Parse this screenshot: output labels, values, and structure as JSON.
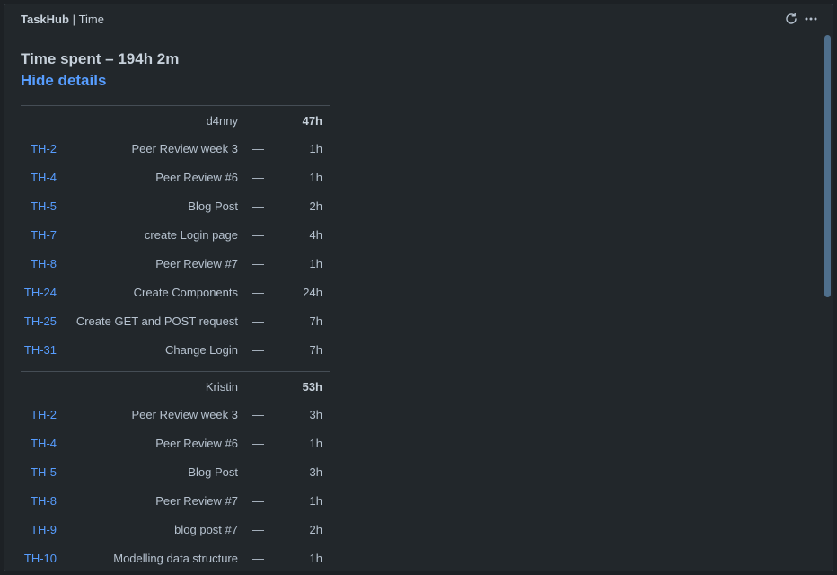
{
  "header": {
    "app": "TaskHub",
    "separator": "|",
    "view": "Time",
    "refresh_icon": "refresh-icon",
    "more_icon": "more-horizontal-icon"
  },
  "summary": {
    "title": "Time spent – 194h 2m",
    "toggle_label": "Hide details"
  },
  "groups": [
    {
      "user": "d4nny",
      "total": "47h",
      "rows": [
        {
          "key": "TH-2",
          "summary": "Peer Review week 3",
          "dash": "—",
          "time": "1h"
        },
        {
          "key": "TH-4",
          "summary": "Peer Review #6",
          "dash": "—",
          "time": "1h"
        },
        {
          "key": "TH-5",
          "summary": "Blog Post",
          "dash": "—",
          "time": "2h"
        },
        {
          "key": "TH-7",
          "summary": "create Login page",
          "dash": "—",
          "time": "4h"
        },
        {
          "key": "TH-8",
          "summary": "Peer Review #7",
          "dash": "—",
          "time": "1h"
        },
        {
          "key": "TH-24",
          "summary": "Create Components",
          "dash": "—",
          "time": "24h"
        },
        {
          "key": "TH-25",
          "summary": "Create GET and POST request",
          "dash": "—",
          "time": "7h"
        },
        {
          "key": "TH-31",
          "summary": "Change Login",
          "dash": "—",
          "time": "7h"
        }
      ]
    },
    {
      "user": "Kristin",
      "total": "53h",
      "rows": [
        {
          "key": "TH-2",
          "summary": "Peer Review week 3",
          "dash": "—",
          "time": "3h"
        },
        {
          "key": "TH-4",
          "summary": "Peer Review #6",
          "dash": "—",
          "time": "1h"
        },
        {
          "key": "TH-5",
          "summary": "Blog Post",
          "dash": "—",
          "time": "3h"
        },
        {
          "key": "TH-8",
          "summary": "Peer Review #7",
          "dash": "—",
          "time": "1h"
        },
        {
          "key": "TH-9",
          "summary": "blog post #7",
          "dash": "—",
          "time": "2h"
        },
        {
          "key": "TH-10",
          "summary": "Modelling data structure",
          "dash": "—",
          "time": "1h"
        }
      ]
    }
  ],
  "colors": {
    "background": "#22272b",
    "link": "#579dff",
    "text": "#b6c2cf",
    "scroll_thumb": "#4f6f8c"
  }
}
